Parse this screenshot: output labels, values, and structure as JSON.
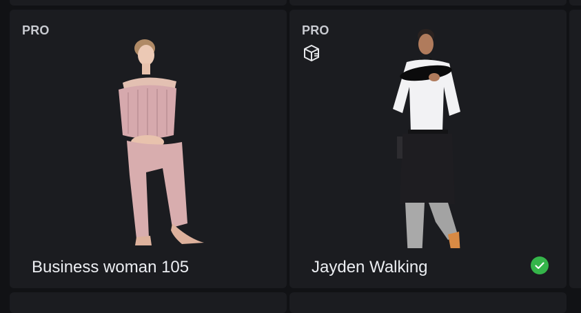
{
  "cards": [
    {
      "badge": "PRO",
      "title": "Business woman 105",
      "image_icon": "person-figure-woman-sitting",
      "selected": false
    },
    {
      "badge": "PRO",
      "title": "Jayden Walking",
      "type_icon": "3d-box-icon",
      "image_icon": "person-figure-waiter-walking",
      "selected": true
    }
  ],
  "colors": {
    "background": "#111215",
    "card": "#1b1c20",
    "check": "#35b54a"
  }
}
